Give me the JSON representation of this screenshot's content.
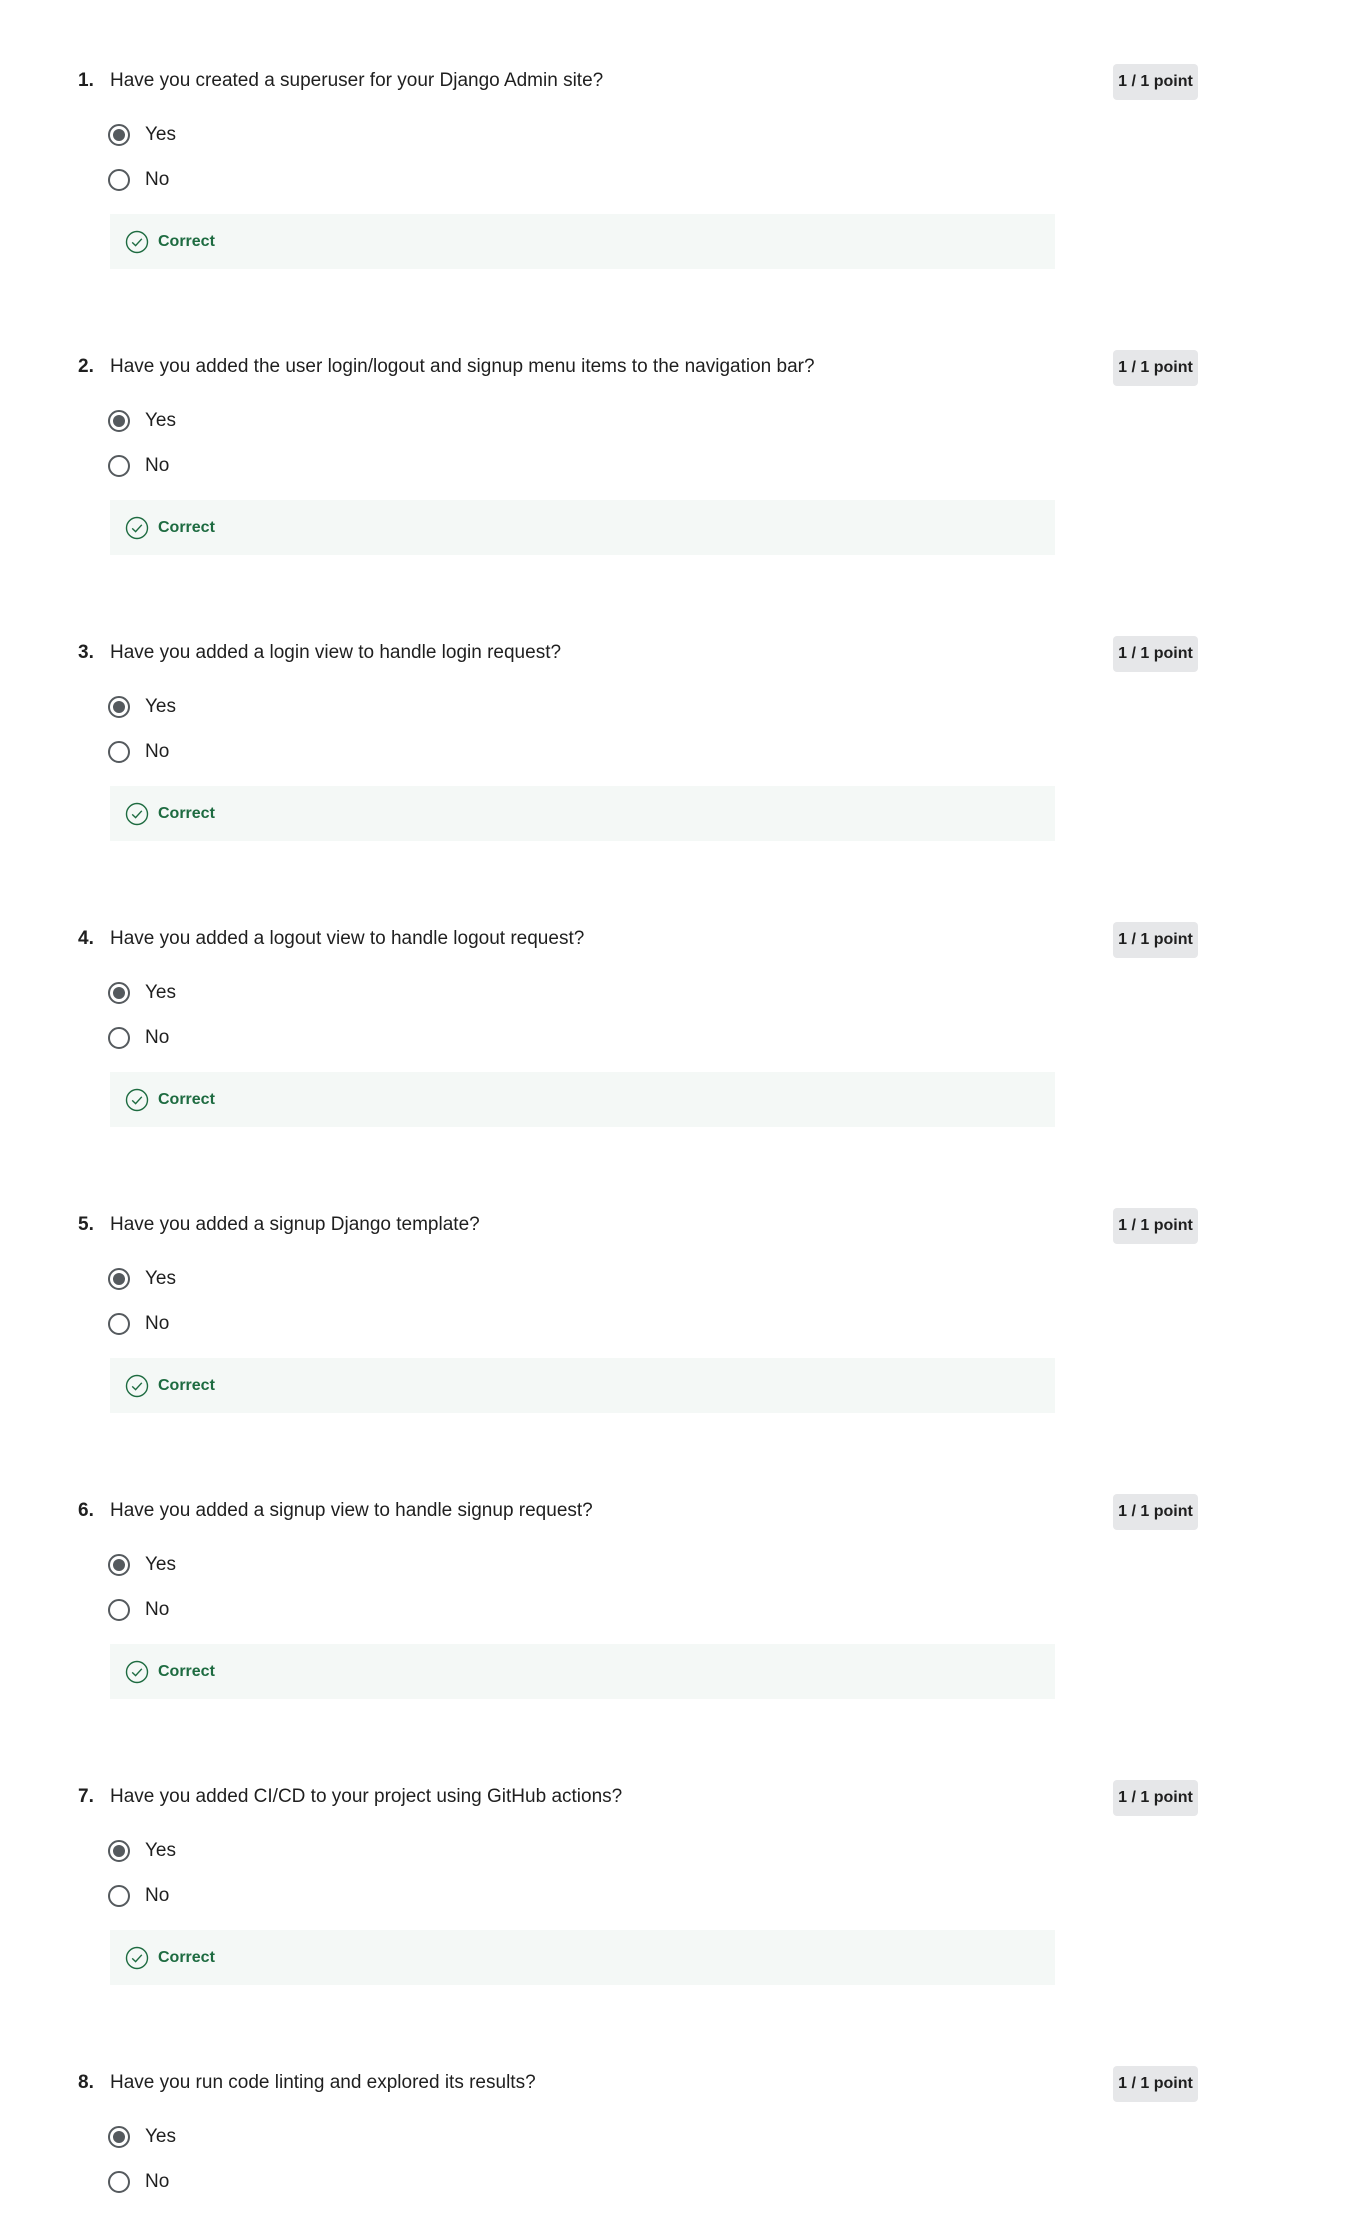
{
  "colors": {
    "correct_text": "#1d6b40",
    "feedback_bg": "#f4f8f6",
    "points_bg": "#e6e7e9",
    "radio": "#555a5e"
  },
  "questions": [
    {
      "number": "1.",
      "text": "Have you created a superuser for your Django Admin site?",
      "points": "1 / 1 point",
      "options": [
        {
          "label": "Yes",
          "selected": true
        },
        {
          "label": "No",
          "selected": false
        }
      ],
      "feedback": "Correct",
      "feedback_icon": "check-circle-icon"
    },
    {
      "number": "2.",
      "text": "Have you added the user login/logout and signup menu items to the navigation bar?",
      "points": "1 / 1 point",
      "options": [
        {
          "label": "Yes",
          "selected": true
        },
        {
          "label": "No",
          "selected": false
        }
      ],
      "feedback": "Correct",
      "feedback_icon": "check-circle-icon"
    },
    {
      "number": "3.",
      "text": "Have you added a login view to handle login request?",
      "points": "1 / 1 point",
      "options": [
        {
          "label": "Yes",
          "selected": true
        },
        {
          "label": "No",
          "selected": false
        }
      ],
      "feedback": "Correct",
      "feedback_icon": "check-circle-icon"
    },
    {
      "number": "4.",
      "text": "Have you added a logout view to handle logout request?",
      "points": "1 / 1 point",
      "options": [
        {
          "label": "Yes",
          "selected": true
        },
        {
          "label": "No",
          "selected": false
        }
      ],
      "feedback": "Correct",
      "feedback_icon": "check-circle-icon"
    },
    {
      "number": "5.",
      "text": "Have you added a signup Django template?",
      "points": "1 / 1 point",
      "options": [
        {
          "label": "Yes",
          "selected": true
        },
        {
          "label": "No",
          "selected": false
        }
      ],
      "feedback": "Correct",
      "feedback_icon": "check-circle-icon"
    },
    {
      "number": "6.",
      "text": "Have you added a signup view to handle signup request?",
      "points": "1 / 1 point",
      "options": [
        {
          "label": "Yes",
          "selected": true
        },
        {
          "label": "No",
          "selected": false
        }
      ],
      "feedback": "Correct",
      "feedback_icon": "check-circle-icon"
    },
    {
      "number": "7.",
      "text": "Have you added CI/CD to your project using GitHub actions?",
      "points": "1 / 1 point",
      "options": [
        {
          "label": "Yes",
          "selected": true
        },
        {
          "label": "No",
          "selected": false
        }
      ],
      "feedback": "Correct",
      "feedback_icon": "check-circle-icon"
    },
    {
      "number": "8.",
      "text": "Have you run code linting and explored its results?",
      "points": "1 / 1 point",
      "options": [
        {
          "label": "Yes",
          "selected": true
        },
        {
          "label": "No",
          "selected": false
        }
      ]
    }
  ]
}
